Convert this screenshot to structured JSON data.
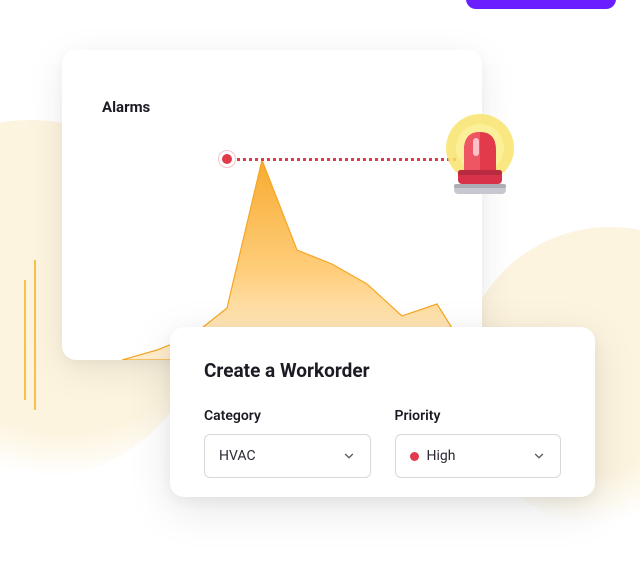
{
  "cta": {
    "visible_fragment": true
  },
  "alarms_card": {
    "title": "Alarms"
  },
  "chart_data": {
    "type": "area",
    "title": "Alarms",
    "xlabel": "",
    "ylabel": "",
    "ylim": [
      0,
      100
    ],
    "x": [
      0,
      1,
      2,
      3,
      4,
      5,
      6,
      7,
      8,
      9,
      10
    ],
    "values": [
      0,
      5,
      12,
      26,
      100,
      55,
      48,
      38,
      22,
      28,
      0
    ],
    "peak_index": 4,
    "peak_value": 100,
    "alarm_threshold": 100
  },
  "siren": {
    "name": "alarm-siren-icon"
  },
  "workorder": {
    "title": "Create a Workorder",
    "category": {
      "label": "Category",
      "selected": "HVAC"
    },
    "priority": {
      "label": "Priority",
      "selected": "High",
      "dot_color": "#e2394b"
    }
  },
  "colors": {
    "accent_purple": "#6b1eff",
    "accent_orange_top": "#f6a623",
    "accent_orange_bottom": "#ffd38a",
    "alarm_red": "#e2394b",
    "text": "#1b1b24"
  }
}
